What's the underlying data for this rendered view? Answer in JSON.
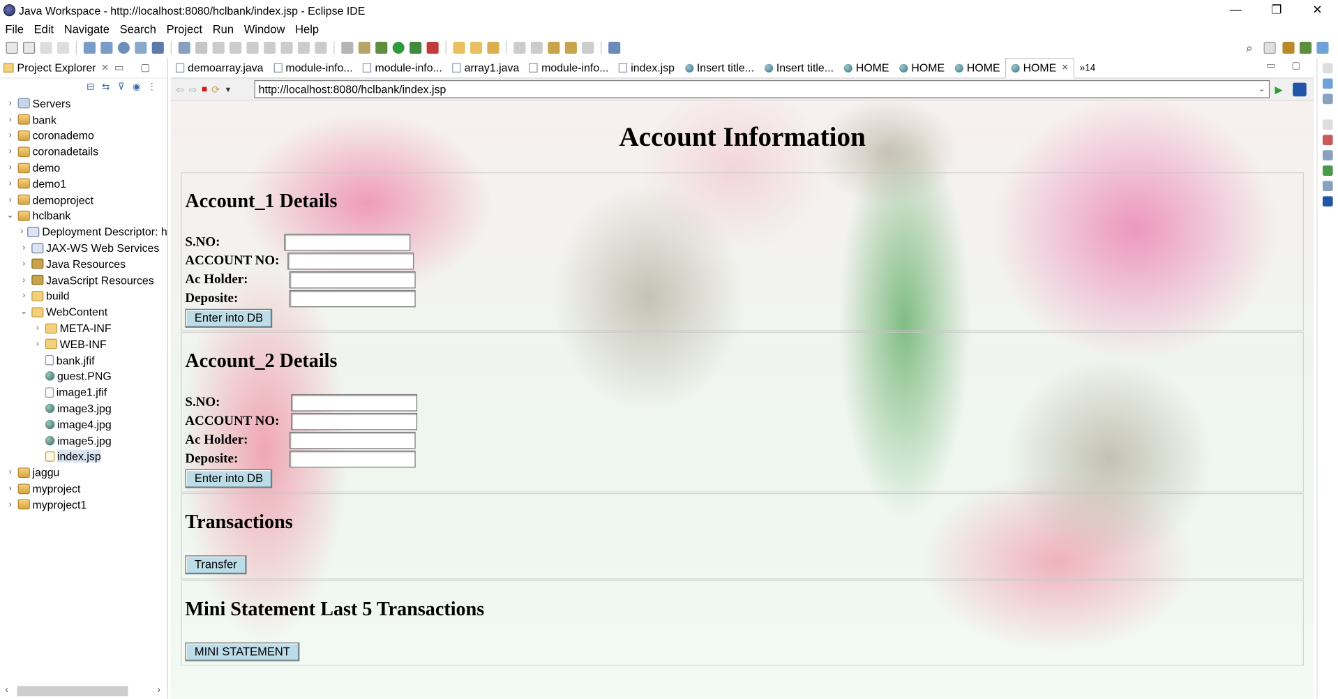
{
  "window": {
    "title": "Java Workspace - http://localhost:8080/hclbank/index.jsp - Eclipse IDE"
  },
  "window_controls": {
    "minimize": "—",
    "restore": "❐",
    "close": "✕"
  },
  "menu": [
    "File",
    "Edit",
    "Navigate",
    "Search",
    "Project",
    "Run",
    "Window",
    "Help"
  ],
  "explorer": {
    "title": "Project Explorer",
    "close": "✕",
    "items": [
      {
        "label": "Servers",
        "icon": "server-icon",
        "depth": 0,
        "expand": "›"
      },
      {
        "label": "bank",
        "icon": "project-icon",
        "depth": 0,
        "expand": "›"
      },
      {
        "label": "coronademo",
        "icon": "project-icon",
        "depth": 0,
        "expand": "›"
      },
      {
        "label": "coronadetails",
        "icon": "project-icon",
        "depth": 0,
        "expand": "›"
      },
      {
        "label": "demo",
        "icon": "project-icon",
        "depth": 0,
        "expand": "›"
      },
      {
        "label": "demo1",
        "icon": "project-icon",
        "depth": 0,
        "expand": "›"
      },
      {
        "label": "demoproject",
        "icon": "project-icon",
        "depth": 0,
        "expand": "›"
      },
      {
        "label": "hclbank",
        "icon": "project-icon",
        "depth": 0,
        "expand": "⌄"
      },
      {
        "label": "Deployment Descriptor: h",
        "icon": "descriptor-icon",
        "depth": 1,
        "expand": "›"
      },
      {
        "label": "JAX-WS Web Services",
        "icon": "webservice-icon",
        "depth": 1,
        "expand": "›"
      },
      {
        "label": "Java Resources",
        "icon": "java-resources-icon",
        "depth": 1,
        "expand": "›"
      },
      {
        "label": "JavaScript Resources",
        "icon": "javascript-resources-icon",
        "depth": 1,
        "expand": "›"
      },
      {
        "label": "build",
        "icon": "folder-icon",
        "depth": 1,
        "expand": "›"
      },
      {
        "label": "WebContent",
        "icon": "folder-icon",
        "depth": 1,
        "expand": "⌄"
      },
      {
        "label": "META-INF",
        "icon": "folder-icon",
        "depth": 2,
        "expand": "›"
      },
      {
        "label": "WEB-INF",
        "icon": "folder-icon",
        "depth": 2,
        "expand": "›"
      },
      {
        "label": "bank.jfif",
        "icon": "file-icon",
        "depth": 2,
        "expand": ""
      },
      {
        "label": "guest.PNG",
        "icon": "image-icon",
        "depth": 2,
        "expand": ""
      },
      {
        "label": "image1.jfif",
        "icon": "file-icon",
        "depth": 2,
        "expand": ""
      },
      {
        "label": "image3.jpg",
        "icon": "image-icon",
        "depth": 2,
        "expand": ""
      },
      {
        "label": "image4.jpg",
        "icon": "image-icon",
        "depth": 2,
        "expand": ""
      },
      {
        "label": "image5.jpg",
        "icon": "image-icon",
        "depth": 2,
        "expand": ""
      },
      {
        "label": "index.jsp",
        "icon": "jsp-icon",
        "depth": 2,
        "expand": "",
        "selected": true
      },
      {
        "label": "jaggu",
        "icon": "project-icon",
        "depth": 0,
        "expand": "›"
      },
      {
        "label": "myproject",
        "icon": "project-icon",
        "depth": 0,
        "expand": "›"
      },
      {
        "label": "myproject1",
        "icon": "project-icon",
        "depth": 0,
        "expand": "›"
      }
    ]
  },
  "editor_tabs": [
    {
      "label": "demoarray.java",
      "kind": "file"
    },
    {
      "label": "module-info...",
      "kind": "file"
    },
    {
      "label": "module-info...",
      "kind": "file"
    },
    {
      "label": "array1.java",
      "kind": "file"
    },
    {
      "label": "module-info...",
      "kind": "file"
    },
    {
      "label": "index.jsp",
      "kind": "file"
    },
    {
      "label": "Insert title...",
      "kind": "web"
    },
    {
      "label": "Insert title...",
      "kind": "web"
    },
    {
      "label": "HOME",
      "kind": "web"
    },
    {
      "label": "HOME",
      "kind": "web"
    },
    {
      "label": "HOME",
      "kind": "web"
    },
    {
      "label": "HOME",
      "kind": "web",
      "active": true
    }
  ],
  "editor_more": "»14",
  "browser": {
    "url": "http://localhost:8080/hclbank/index.jsp"
  },
  "page": {
    "title": "Account Information",
    "account1": {
      "heading": "Account_1 Details",
      "sno_label": "S.NO:",
      "account_no_label": "ACCOUNT NO:",
      "holder_label": "Ac Holder:",
      "deposit_label": "Deposite:",
      "submit": "Enter into DB"
    },
    "account2": {
      "heading": "Account_2 Details",
      "sno_label": "S.NO:",
      "account_no_label": "ACCOUNT NO:",
      "holder_label": "Ac Holder:",
      "deposit_label": "Deposite:",
      "submit": "Enter into DB"
    },
    "transactions": {
      "heading": "Transactions",
      "button": "Transfer"
    },
    "mini": {
      "heading": "Mini Statement Last 5 Transactions",
      "button": "MINI STATEMENT"
    }
  }
}
